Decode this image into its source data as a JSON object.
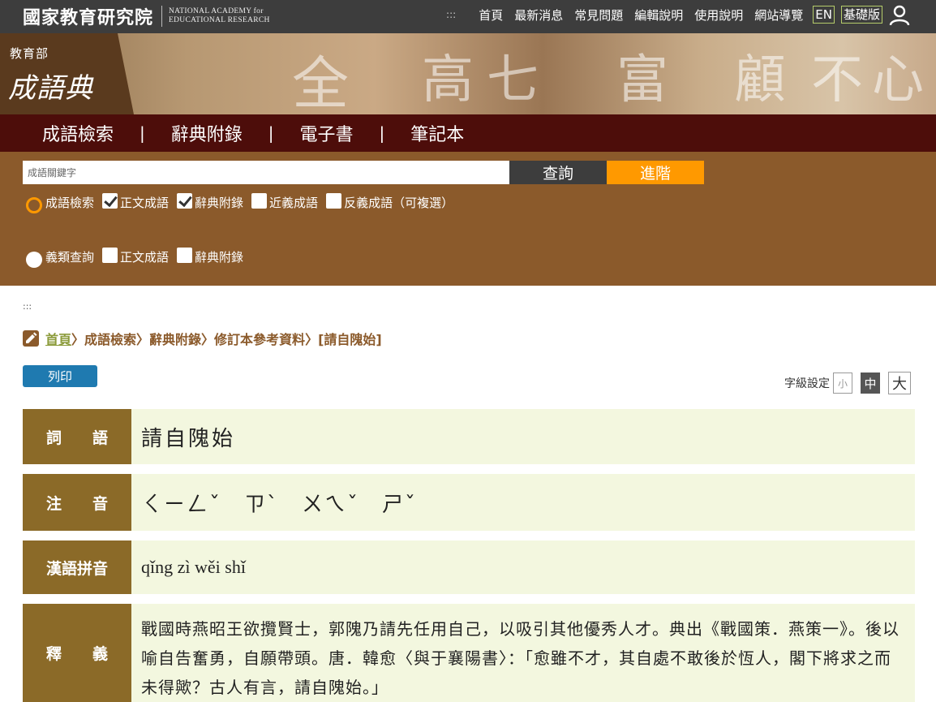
{
  "header": {
    "logo_cn": "國家教育研究院",
    "logo_en_line1": "NATIONAL ACADEMY for",
    "logo_en_line2": "EDUCATIONAL RESEARCH",
    "accesskey": ":::",
    "links": [
      "首頁",
      "最新消息",
      "常見問題",
      "編輯說明",
      "使用說明",
      "網站導覽"
    ],
    "lang_en": "EN",
    "basic_version": "基礎版"
  },
  "banner": {
    "org": "教育部",
    "title": "成語典",
    "deco_chars": [
      "全",
      "高",
      "七",
      "富",
      "顧",
      "不",
      "心"
    ]
  },
  "main_nav": [
    "成語檢索",
    "辭典附錄",
    "電子書",
    "筆記本"
  ],
  "search": {
    "placeholder": "成語關鍵字",
    "query_button": "查詢",
    "advanced_button": "進階",
    "row1": {
      "radio_label": "成語檢索",
      "options": [
        {
          "label": "正文成語",
          "checked": true
        },
        {
          "label": "辭典附錄",
          "checked": true
        },
        {
          "label": "近義成語",
          "checked": false
        },
        {
          "label": "反義成語",
          "checked": false
        }
      ],
      "note": "（可複選）"
    },
    "row2": {
      "radio_label": "義類查詢",
      "options": [
        {
          "label": "正文成語",
          "checked": false
        },
        {
          "label": "辭典附錄",
          "checked": false
        }
      ]
    }
  },
  "content": {
    "accesskey": ":::",
    "breadcrumb": {
      "home": "首頁",
      "items": [
        "〉成語檢索",
        "〉辭典附錄",
        "〉修訂本參考資料",
        "〉[請自隗始]"
      ]
    },
    "print_button": "列印",
    "font_size": {
      "label": "字級設定",
      "small": "小",
      "medium": "中",
      "large": "大"
    },
    "entry": {
      "word_label_a": "詞",
      "word_label_b": "語",
      "word": "請自隗始",
      "zhuyin_label_a": "注",
      "zhuyin_label_b": "音",
      "zhuyin": "ㄑㄧㄥˇ　ㄗˋ　ㄨㄟˇ　ㄕˇ",
      "pinyin_label": "漢語拼音",
      "pinyin": "qǐng zì wěi shǐ",
      "def_label_a": "釋",
      "def_label_b": "義",
      "definition": "戰國時燕昭王欲攬賢士，郭隗乃請先任用自己，以吸引其他優秀人才。典出《戰國策．燕策一》。後以喻自告奮勇，自願帶頭。唐．韓愈〈與于襄陽書〉：「愈雖不才，其自處不敢後於恆人，閣下將求之而未得歟？古人有言，請自隗始。」"
    }
  }
}
